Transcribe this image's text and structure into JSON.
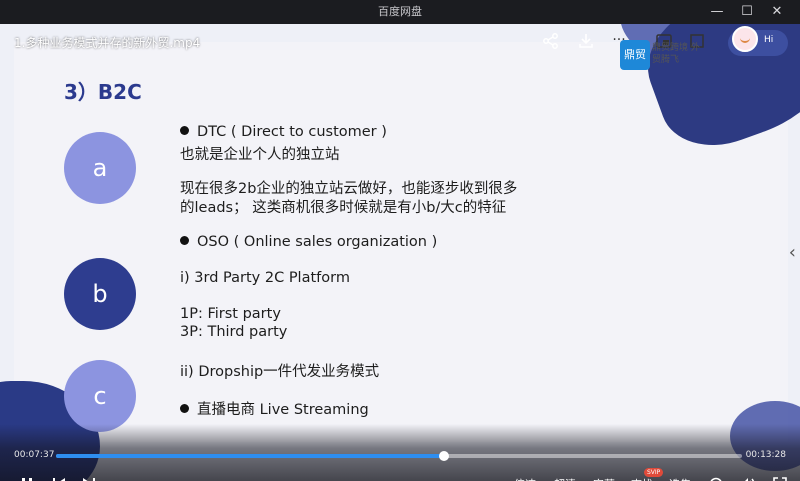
{
  "app": {
    "window_title": "百度网盘",
    "controls": {
      "minimize": "—",
      "maximize": "☐",
      "close": "✕"
    }
  },
  "video": {
    "title": "1.多种业务模式并存的新外贸.mp4",
    "top_icons": [
      "share-icon",
      "download-icon",
      "more-icon",
      "picture-in-picture-icon",
      "window-icon"
    ],
    "more_label": "···",
    "logo": {
      "mark": "鼎贸",
      "text": "鼎贸跨境 外贸腾飞"
    },
    "hi_badge": "Hi",
    "side_arrow": "‹"
  },
  "slide": {
    "heading": "3）B2C",
    "circles": [
      "a",
      "b",
      "c"
    ],
    "lines": [
      "DTC ( Direct to customer )",
      "也就是企业个人的独立站",
      "现在很多2b企业的独立站云做好，也能逐步收到很多",
      "的leads；  这类商机很多时候就是有小b/大c的特征",
      "OSO ( Online sales organization )",
      "i) 3rd Party 2C Platform",
      "1P: First party",
      "3P: Third party",
      "ii) Dropship一件代发业务模式",
      "直播电商   Live Streaming"
    ]
  },
  "player": {
    "current_time": "00:07:37",
    "total_time": "00:13:28",
    "progress": 0.565,
    "buttons": {
      "speed": "倍速",
      "quality": "超清",
      "subtitle": "字幕",
      "find": "查找",
      "episodes": "选集"
    },
    "svip": "SVIP",
    "accent_color": "#2e8ef0"
  }
}
